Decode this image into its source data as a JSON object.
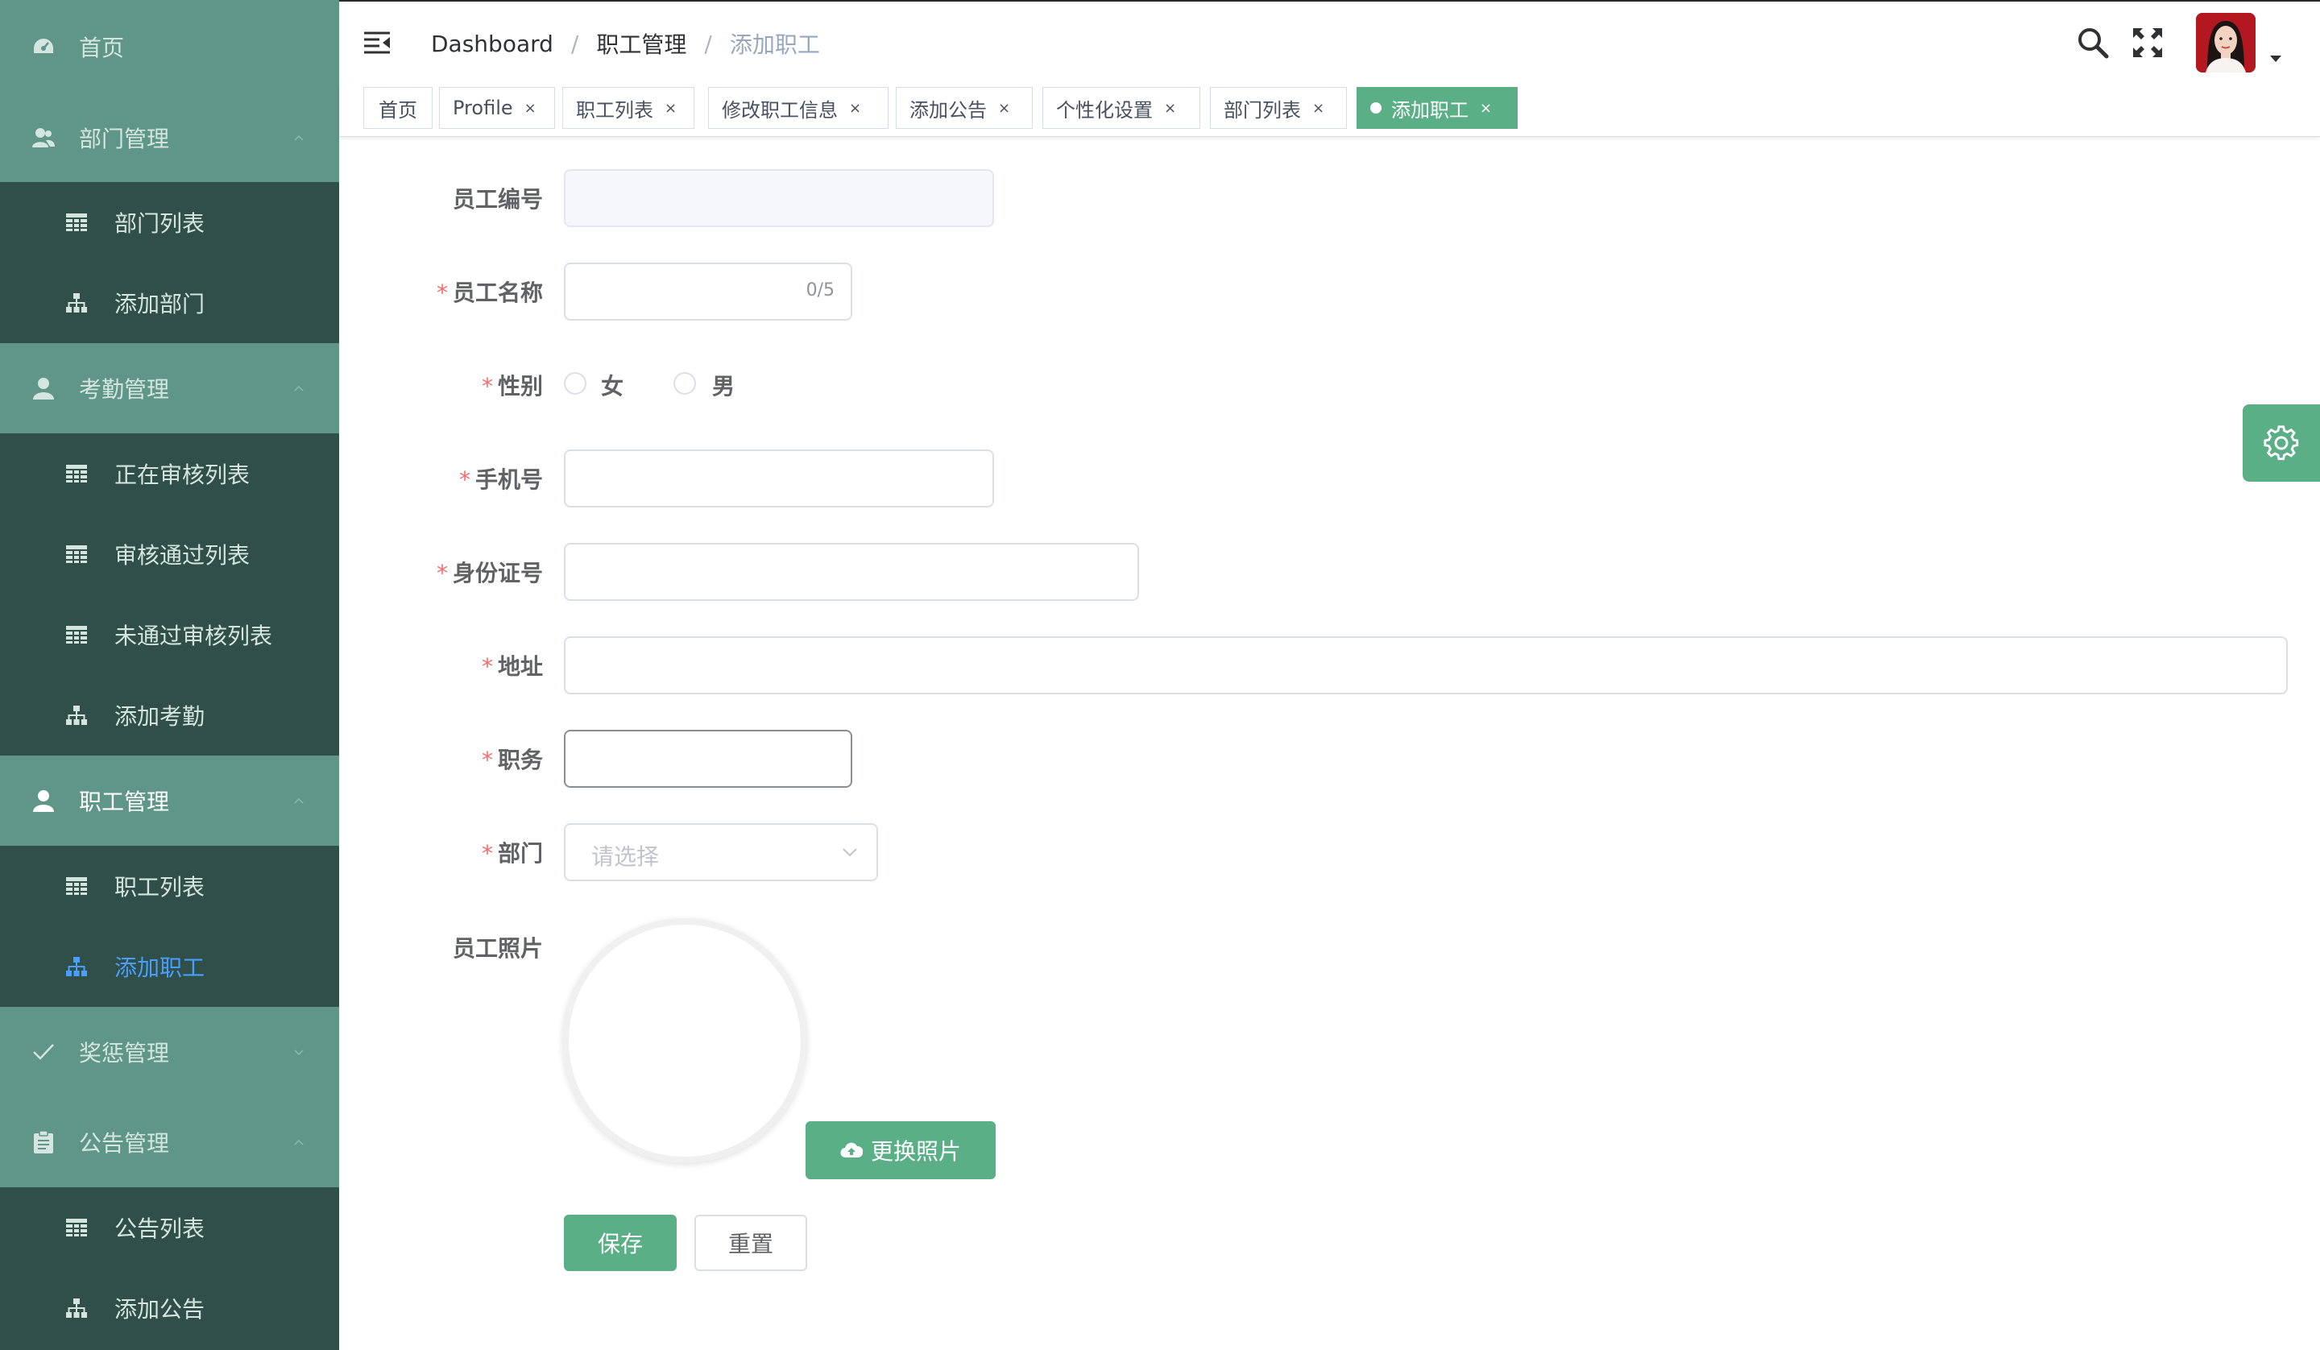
{
  "sidebar": {
    "home": {
      "label": "首页",
      "icon": "dashboard-icon"
    },
    "groups": [
      {
        "label": "部门管理",
        "icon": "team-icon",
        "items": [
          {
            "label": "部门列表",
            "icon": "table-icon"
          },
          {
            "label": "添加部门",
            "icon": "tree-icon"
          }
        ]
      },
      {
        "label": "考勤管理",
        "icon": "user-icon",
        "items": [
          {
            "label": "正在审核列表",
            "icon": "table-icon"
          },
          {
            "label": "审核通过列表",
            "icon": "table-icon"
          },
          {
            "label": "未通过审核列表",
            "icon": "table-icon"
          },
          {
            "label": "添加考勤",
            "icon": "tree-icon"
          }
        ]
      },
      {
        "label": "职工管理",
        "icon": "user-icon",
        "items": [
          {
            "label": "职工列表",
            "icon": "table-icon"
          },
          {
            "label": "添加职工",
            "icon": "tree-icon"
          }
        ]
      },
      {
        "label": "奖惩管理",
        "icon": "check-icon",
        "items": []
      },
      {
        "label": "公告管理",
        "icon": "clipboard-icon",
        "items": [
          {
            "label": "公告列表",
            "icon": "table-icon"
          },
          {
            "label": "添加公告",
            "icon": "tree-icon"
          }
        ]
      }
    ],
    "colors": {
      "group_bg": "#5f9688",
      "item_bg": "#2f4f48",
      "selected": "#4a9eff"
    }
  },
  "header": {
    "breadcrumb": [
      "Dashboard",
      "职工管理",
      "添加职工"
    ],
    "icons": [
      "search-icon",
      "fullscreen-icon"
    ]
  },
  "tags": [
    {
      "label": "首页",
      "closable": false
    },
    {
      "label": "Profile",
      "close": "×"
    },
    {
      "label": "职工列表",
      "close": "×"
    },
    {
      "label": "修改职工信息",
      "close": "×"
    },
    {
      "label": "添加公告",
      "close": "×"
    },
    {
      "label": "个性化设置",
      "close": "×"
    },
    {
      "label": "部门列表",
      "close": "×"
    },
    {
      "label": "添加职工",
      "close": "×",
      "active": true
    }
  ],
  "form": {
    "emp_no": {
      "label": "员工编号",
      "value": ""
    },
    "emp_name": {
      "label": "员工名称",
      "value": "",
      "counter": "0/5"
    },
    "gender": {
      "label": "性别",
      "options": [
        "女",
        "男"
      ]
    },
    "phone": {
      "label": "手机号",
      "value": ""
    },
    "id_card": {
      "label": "身份证号",
      "value": ""
    },
    "address": {
      "label": "地址",
      "value": ""
    },
    "position": {
      "label": "职务",
      "value": ""
    },
    "department": {
      "label": "部门",
      "placeholder": "请选择"
    },
    "photo": {
      "label": "员工照片",
      "button": "更换照片"
    },
    "required_mark": "*",
    "save": "保存",
    "reset": "重置"
  },
  "theme": {
    "primary": "#5aaf87",
    "required": "#f56c6c"
  }
}
